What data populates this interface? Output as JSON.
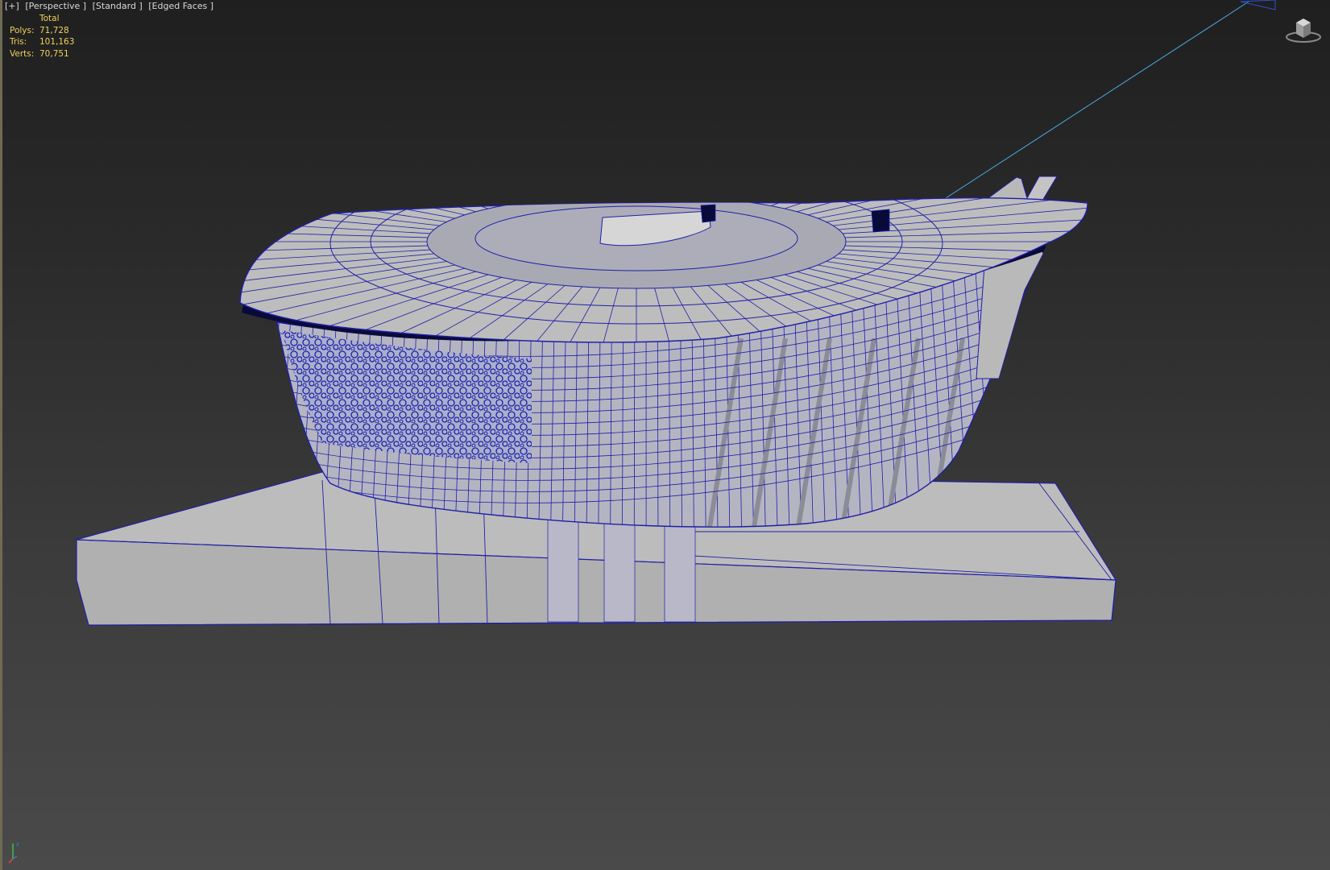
{
  "viewport": {
    "menu": {
      "plus_label": "[+]",
      "view_label": "[Perspective ]",
      "shading_label": "[Standard ]",
      "style_label": "[Edged Faces ]"
    },
    "stats": {
      "header": "Total",
      "rows": [
        {
          "label": "Polys:",
          "value": "71,728"
        },
        {
          "label": "Tris:",
          "value": "101,163"
        },
        {
          "label": "Verts:",
          "value": "70,751"
        }
      ]
    },
    "icons": {
      "viewcube": "viewcube-icon",
      "axis_tripod": "axis-tripod-icon"
    }
  },
  "colors": {
    "stats_text": "#f0d25a",
    "wireframe_edge": "#1f1fa8",
    "mesh_face": "#bcbcbc",
    "viewport_bg_top": "#1f1f1f",
    "viewport_bg_bottom": "#4a4a4a"
  }
}
